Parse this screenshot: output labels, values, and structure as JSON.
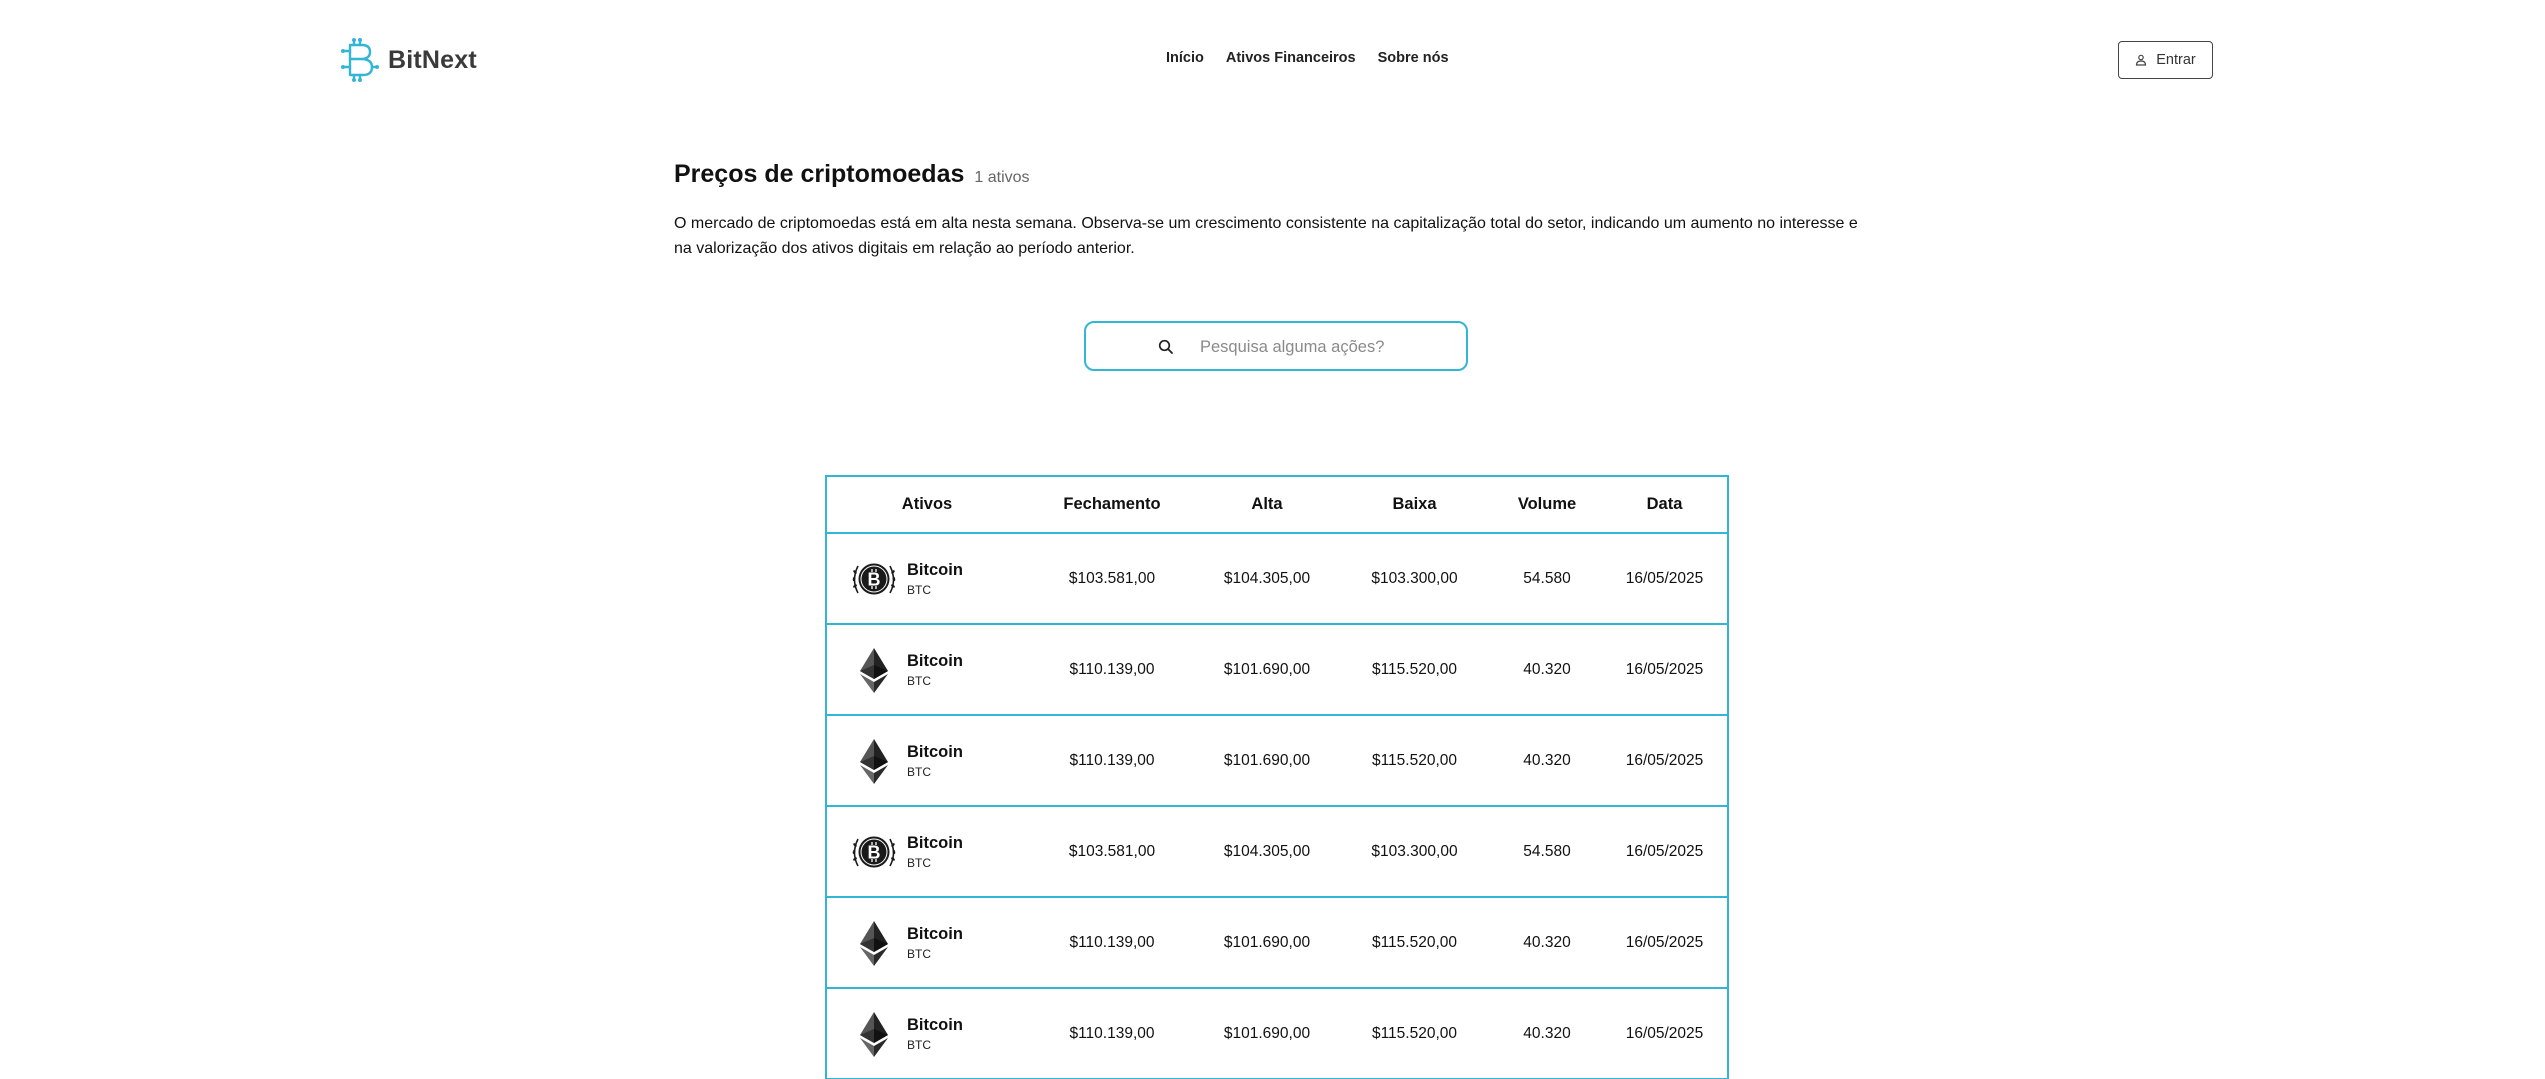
{
  "brand": {
    "name": "BitNext",
    "logo_icon": "bitcoin-circuit-logo",
    "accent_color": "#33b6d6"
  },
  "nav": {
    "items": [
      {
        "label": "Início"
      },
      {
        "label": "Ativos Financeiros"
      },
      {
        "label": "Sobre nós"
      }
    ]
  },
  "login": {
    "label": "Entrar",
    "icon": "user-icon"
  },
  "main": {
    "title": "Preços de criptomoedas",
    "count": "1 ativos",
    "intro": "O mercado de criptomoedas está em alta nesta semana. Observa-se um crescimento consistente na capitalização total do setor, indicando um aumento no interesse e na valorização dos ativos digitais em relação ao período anterior."
  },
  "search": {
    "placeholder": "Pesquisa alguma ações?",
    "value": ""
  },
  "table": {
    "headers": [
      "Ativos",
      "Fechamento",
      "Alta",
      "Baixa",
      "Volume",
      "Data"
    ],
    "rows": [
      {
        "icon": "bitcoin-icon",
        "name": "Bitcoin",
        "symbol": "BTC",
        "close": "$103.581,00",
        "high": "$104.305,00",
        "low": "$103.300,00",
        "volume": "54.580",
        "date": "16/05/2025"
      },
      {
        "icon": "ethereum-icon",
        "name": "Bitcoin",
        "symbol": "BTC",
        "close": "$110.139,00",
        "high": "$101.690,00",
        "low": "$115.520,00",
        "volume": "40.320",
        "date": "16/05/2025"
      },
      {
        "icon": "ethereum-icon",
        "name": "Bitcoin",
        "symbol": "BTC",
        "close": "$110.139,00",
        "high": "$101.690,00",
        "low": "$115.520,00",
        "volume": "40.320",
        "date": "16/05/2025"
      },
      {
        "icon": "bitcoin-icon",
        "name": "Bitcoin",
        "symbol": "BTC",
        "close": "$103.581,00",
        "high": "$104.305,00",
        "low": "$103.300,00",
        "volume": "54.580",
        "date": "16/05/2025"
      },
      {
        "icon": "ethereum-icon",
        "name": "Bitcoin",
        "symbol": "BTC",
        "close": "$110.139,00",
        "high": "$101.690,00",
        "low": "$115.520,00",
        "volume": "40.320",
        "date": "16/05/2025"
      },
      {
        "icon": "ethereum-icon",
        "name": "Bitcoin",
        "symbol": "BTC",
        "close": "$110.139,00",
        "high": "$101.690,00",
        "low": "$115.520,00",
        "volume": "40.320",
        "date": "16/05/2025"
      }
    ]
  }
}
